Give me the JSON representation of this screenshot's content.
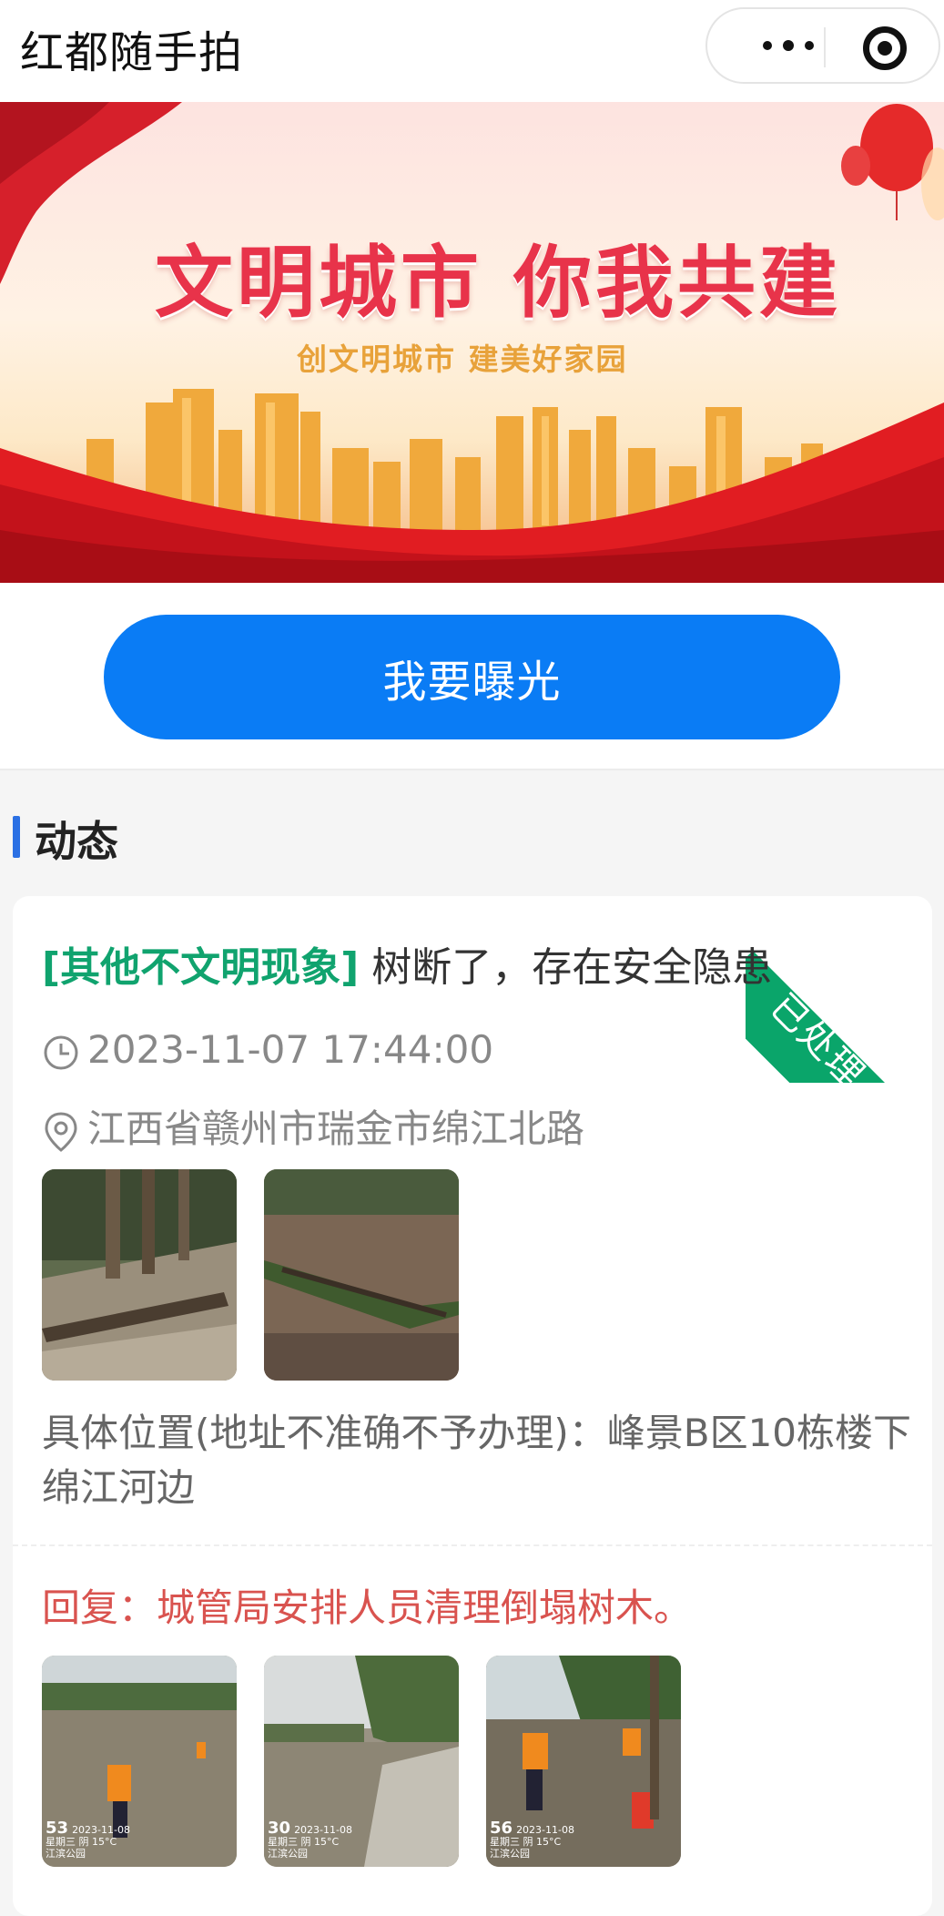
{
  "app": {
    "title": "红都随手拍"
  },
  "banner": {
    "headline": "文明城市  你我共建",
    "subline": "创文明城市  建美好家园"
  },
  "actions": {
    "expose_label": "我要曝光"
  },
  "section": {
    "title": "动态"
  },
  "post": {
    "status": "已处理",
    "category": "[其他不文明现象]",
    "title": " 树断了，存在安全隐患",
    "time": "2023-11-07 17:44:00",
    "location": "江西省赣州市瑞金市绵江北路",
    "detail": "具体位置(地址不准确不予办理)：峰景B区10栋楼下绵江河边",
    "reply": "回复：城管局安排人员清理倒塌树木。",
    "reply_photos": [
      {
        "num": "53",
        "date": "2023-11-08",
        "week": "星期三  阴 15°C",
        "place": "江滨公园"
      },
      {
        "num": "30",
        "date": "2023-11-08",
        "week": "星期三  阴 15°C",
        "place": "江滨公园"
      },
      {
        "num": "56",
        "date": "2023-11-08",
        "week": "星期三  阴 15°C",
        "place": "江滨公园"
      }
    ]
  },
  "colors": {
    "primary": "#0a7cf5",
    "status_green": "#0aa56a",
    "category_green": "#10a36e",
    "reply_red": "#d9534f",
    "section_bar": "#2b70e4"
  },
  "icons": [
    "more-dots-icon",
    "target-icon",
    "clock-icon",
    "location-pin-icon"
  ]
}
